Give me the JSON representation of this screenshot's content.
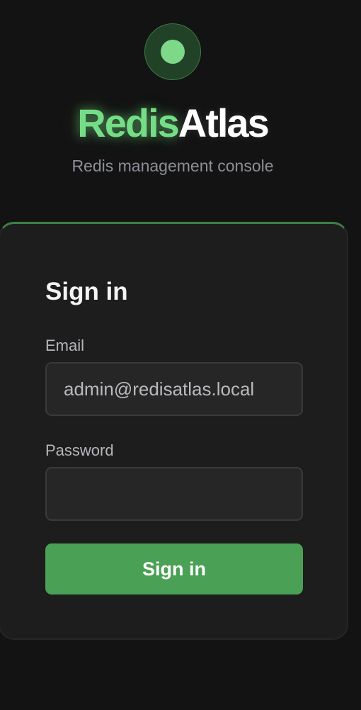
{
  "brand": {
    "name_part1": "Redis",
    "name_part2": "Atlas",
    "subtitle": "Redis management console",
    "logo_icon": "circle-dot-icon",
    "accent_color": "#75dd85"
  },
  "login_card": {
    "title": "Sign in",
    "email": {
      "label": "Email",
      "value": "admin@redisatlas.local",
      "type": "email"
    },
    "password": {
      "label": "Password",
      "value": "",
      "type": "password"
    },
    "submit_label": "Sign in",
    "button_color": "#4aa054"
  }
}
